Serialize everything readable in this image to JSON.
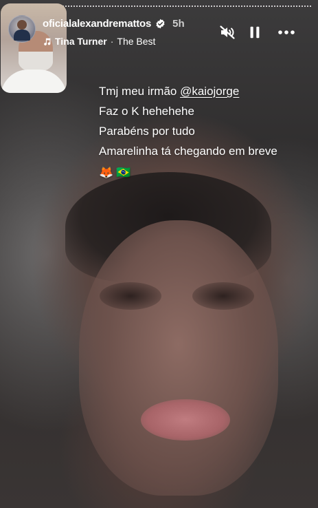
{
  "header": {
    "username": "oficialalexandremattos",
    "time_ago": "5h",
    "music": {
      "artist": "Tina Turner",
      "separator": "·",
      "title": "The Best"
    }
  },
  "caption": {
    "line1_prefix": "Tmj meu irmão ",
    "line1_mention": "@kaiojorge",
    "line2": "Faz o K hehehehe",
    "line3": "Parabéns por tudo",
    "line4": "Amarelinha tá chegando em breve",
    "emoji_fox": "🦊",
    "emoji_flag": "🇧🇷"
  },
  "icons": [
    "verified-icon",
    "music-note-icon",
    "mute-icon",
    "pause-icon",
    "more-icon"
  ],
  "colors": {
    "verified": "#ffffff",
    "text": "#ffffff"
  }
}
